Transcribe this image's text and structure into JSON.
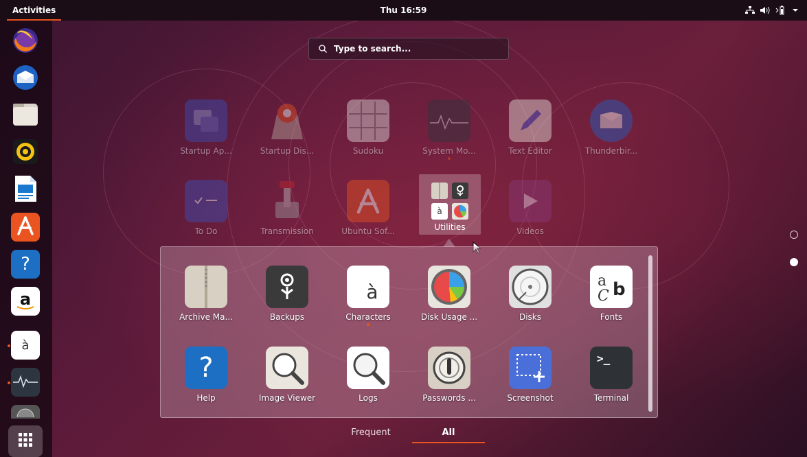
{
  "topbar": {
    "activities": "Activities",
    "clock": "Thu 16:59",
    "tray": [
      "network-icon",
      "volume-icon",
      "battery-icon",
      "menu-arrow-icon"
    ]
  },
  "dock": {
    "items": [
      {
        "name": "Firefox",
        "icon": "firefox-icon"
      },
      {
        "name": "Thunderbird",
        "icon": "thunderbird-icon"
      },
      {
        "name": "Files",
        "icon": "files-icon"
      },
      {
        "name": "Rhythmbox",
        "icon": "rhythmbox-icon"
      },
      {
        "name": "LibreOffice Writer",
        "icon": "writer-icon"
      },
      {
        "name": "Ubuntu Software",
        "icon": "software-icon"
      },
      {
        "name": "Help",
        "icon": "help-icon",
        "glyph": "?"
      },
      {
        "name": "Amazon",
        "icon": "amazon-icon",
        "glyph": "a"
      },
      {
        "name": "Characters",
        "icon": "characters-icon",
        "glyph": "à",
        "running": true
      },
      {
        "name": "System Monitor",
        "icon": "system-monitor-icon",
        "running": true
      },
      {
        "name": "Disk Usage",
        "icon": "disk-usage-icon"
      }
    ],
    "show_apps": "show-applications-icon"
  },
  "search": {
    "placeholder": "Type to search..."
  },
  "grid": {
    "row1": [
      "Startup Ap...",
      "Startup Dis...",
      "Sudoku",
      "System Mo...",
      "Text Editor",
      "Thunderbir..."
    ],
    "row2": [
      "To Do",
      "Transmission",
      "Ubuntu Sof...",
      "Utilities",
      "Videos"
    ]
  },
  "folder": {
    "apps": [
      {
        "label": "Archive Ma...",
        "icon": "archive-manager-icon"
      },
      {
        "label": "Backups",
        "icon": "backups-icon"
      },
      {
        "label": "Characters",
        "icon": "characters-icon",
        "glyph": "à",
        "running": true
      },
      {
        "label": "Disk Usage ...",
        "icon": "disk-usage-icon"
      },
      {
        "label": "Disks",
        "icon": "disks-icon"
      },
      {
        "label": "Fonts",
        "icon": "fonts-icon",
        "glyph": "ab"
      },
      {
        "label": "Help",
        "icon": "help-icon",
        "glyph": "?"
      },
      {
        "label": "Image Viewer",
        "icon": "image-viewer-icon"
      },
      {
        "label": "Logs",
        "icon": "logs-icon"
      },
      {
        "label": "Passwords ...",
        "icon": "passwords-icon"
      },
      {
        "label": "Screenshot",
        "icon": "screenshot-icon"
      },
      {
        "label": "Terminal",
        "icon": "terminal-icon",
        "glyph": ">_"
      }
    ]
  },
  "tabs": {
    "frequent": "Frequent",
    "all": "All",
    "active": "All"
  },
  "colors": {
    "accent": "#e95420",
    "topbar": "#1a0d16"
  }
}
